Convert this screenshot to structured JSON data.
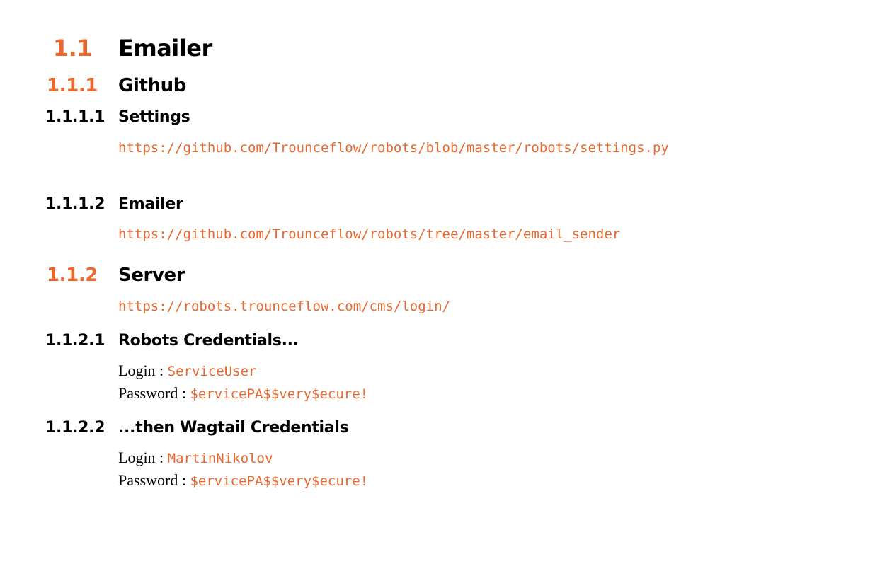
{
  "sections": {
    "s1": {
      "number": "1.1",
      "title": "Emailer"
    },
    "s11": {
      "number": "1.1.1",
      "title": "Github"
    },
    "s111": {
      "number": "1.1.1.1",
      "title": "Settings",
      "link": "https://github.com/Trounceflow/robots/blob/master/robots/settings.py"
    },
    "s112": {
      "number": "1.1.1.2",
      "title": "Emailer",
      "link": "https://github.com/Trounceflow/robots/tree/master/email_sender"
    },
    "s12": {
      "number": "1.1.2",
      "title": "Server",
      "link": "https://robots.trounceflow.com/cms/login/"
    },
    "s121": {
      "number": "1.1.2.1",
      "title": "Robots Credentials...",
      "login_label": "Login : ",
      "login_value": "ServiceUser",
      "password_label": "Password : ",
      "password_value": "$ervicePA$$very$ecure!"
    },
    "s122": {
      "number": "1.1.2.2",
      "title": "...then Wagtail Credentials",
      "login_label": "Login : ",
      "login_value": "MartinNikolov",
      "password_label": "Password : ",
      "password_value": "$ervicePA$$very$ecure!"
    }
  },
  "colors": {
    "accent": "#e8692f",
    "text": "#000000",
    "background": "#ffffff"
  }
}
